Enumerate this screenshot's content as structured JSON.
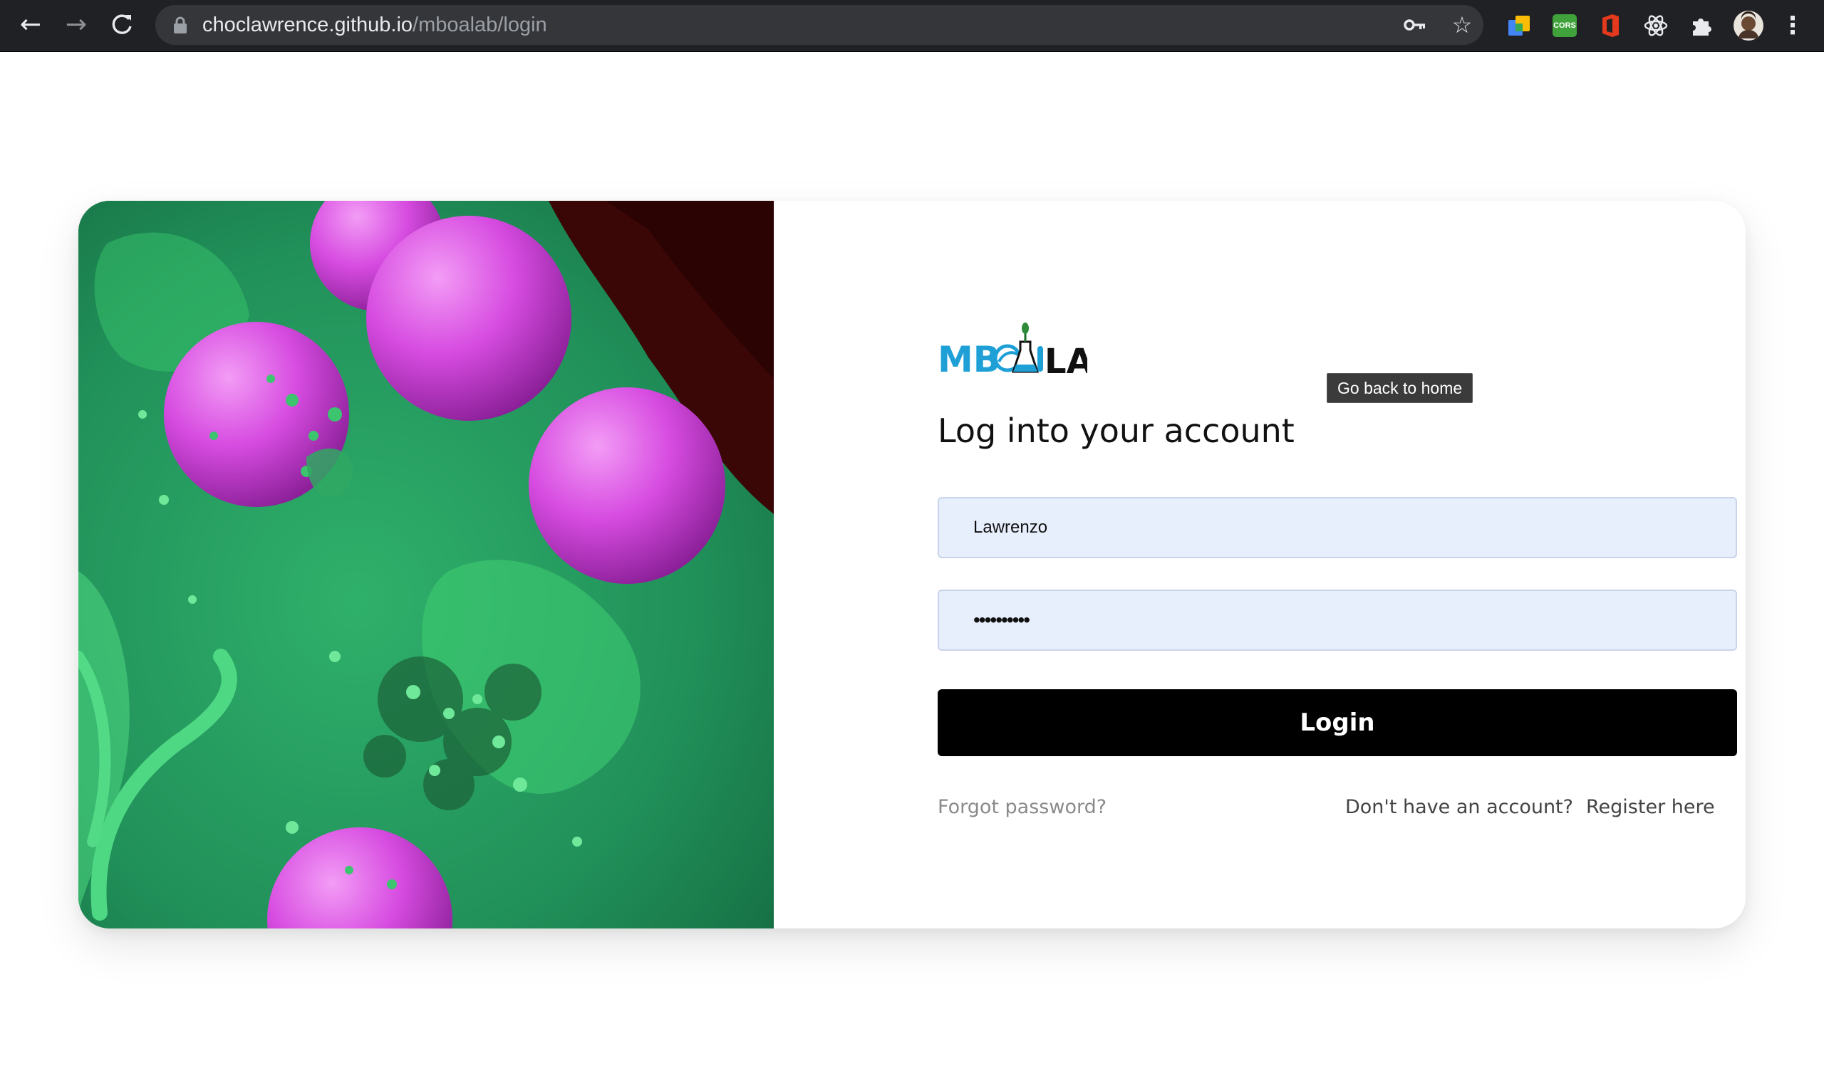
{
  "browser": {
    "url_host": "choclawrence.github.io",
    "url_path": "/mboalab/login",
    "extensions": [
      "google-translate-icon",
      "cors-icon",
      "office-icon",
      "react-devtools-icon",
      "puzzle-icon"
    ],
    "cors_label": "CORS"
  },
  "logo": {
    "left_text": "MB",
    "right_text": "LAB"
  },
  "tooltip": "Go back to home",
  "login": {
    "heading": "Log into your account",
    "username_value": "Lawrenzo",
    "password_value": "••••••••••",
    "button_label": "Login",
    "forgot_label": "Forgot password?",
    "no_account_label": "Don't have an account?",
    "register_label": "Register here"
  },
  "colors": {
    "brand_blue": "#1ea0d7",
    "input_bg": "#e8effc",
    "button_bg": "#000000"
  }
}
